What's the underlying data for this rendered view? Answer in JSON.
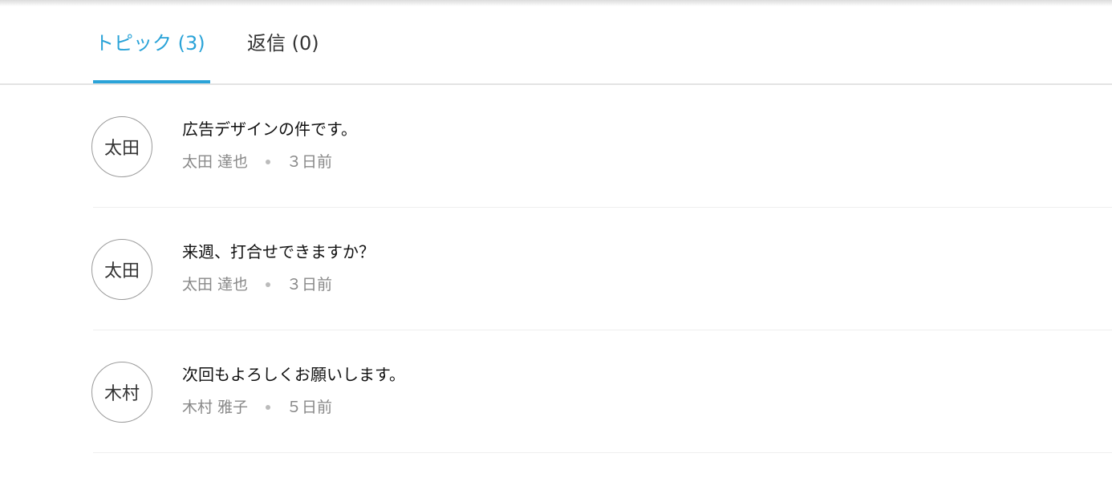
{
  "theme": {
    "accent": "#2aa3d8"
  },
  "tabs": [
    {
      "label": "トピック (3)",
      "active": true
    },
    {
      "label": "返信 (0)",
      "active": false
    }
  ],
  "topics": [
    {
      "avatar": "太田",
      "title": "広告デザインの件です。",
      "author": "太田 達也",
      "time": "３日前"
    },
    {
      "avatar": "太田",
      "title": "来週、打合せできますか？",
      "author": "太田 達也",
      "time": "３日前"
    },
    {
      "avatar": "木村",
      "title": "次回もよろしくお願いします。",
      "author": "木村 雅子",
      "time": "５日前"
    }
  ]
}
